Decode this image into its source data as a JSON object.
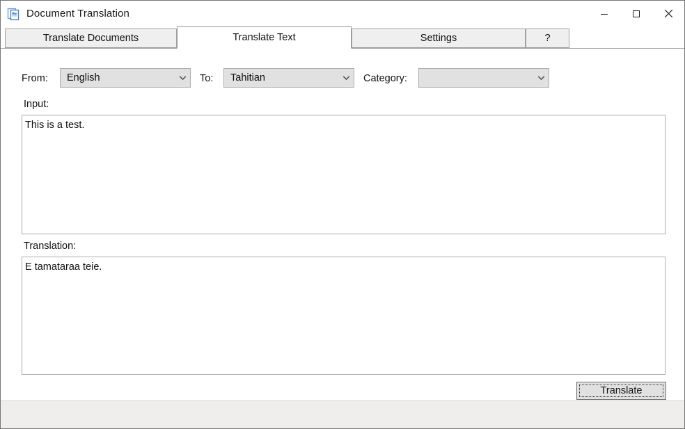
{
  "window": {
    "title": "Document Translation",
    "icon": "document-translation-icon",
    "controls": [
      {
        "name": "minimize-button",
        "glyph": "minimize-icon"
      },
      {
        "name": "maximize-button",
        "glyph": "maximize-icon"
      },
      {
        "name": "close-button",
        "glyph": "close-icon"
      }
    ]
  },
  "tabs": [
    {
      "label": "Translate Documents",
      "selected": false
    },
    {
      "label": "Translate Text",
      "selected": true
    },
    {
      "label": "Settings",
      "selected": false
    },
    {
      "label": "?",
      "selected": false
    }
  ],
  "form": {
    "from": {
      "label": "From:",
      "value": "English"
    },
    "to": {
      "label": "To:",
      "value": "Tahitian"
    },
    "category": {
      "label": "Category:",
      "value": ""
    }
  },
  "input_panel": {
    "label": "Input:",
    "value": "This is a test."
  },
  "translation_panel": {
    "label": "Translation:",
    "value": "E tamataraa teie."
  },
  "actions": {
    "translate_label": "Translate"
  },
  "statusbar": {
    "text": ""
  },
  "colors": {
    "window_bg": "#ffffff",
    "tab_bg": "#efefef",
    "tab_selected_bg": "#ffffff",
    "tab_border": "#9e9e9e",
    "combo_bg": "#e1e1e1",
    "combo_border": "#adadad",
    "textbox_border": "#aaaaaa",
    "button_bg": "#e1e1e1",
    "button_border": "#6e6e6e",
    "statusbar_bg": "#f0eeed",
    "text": "#101010",
    "icon_blue": "#4a90d9"
  }
}
